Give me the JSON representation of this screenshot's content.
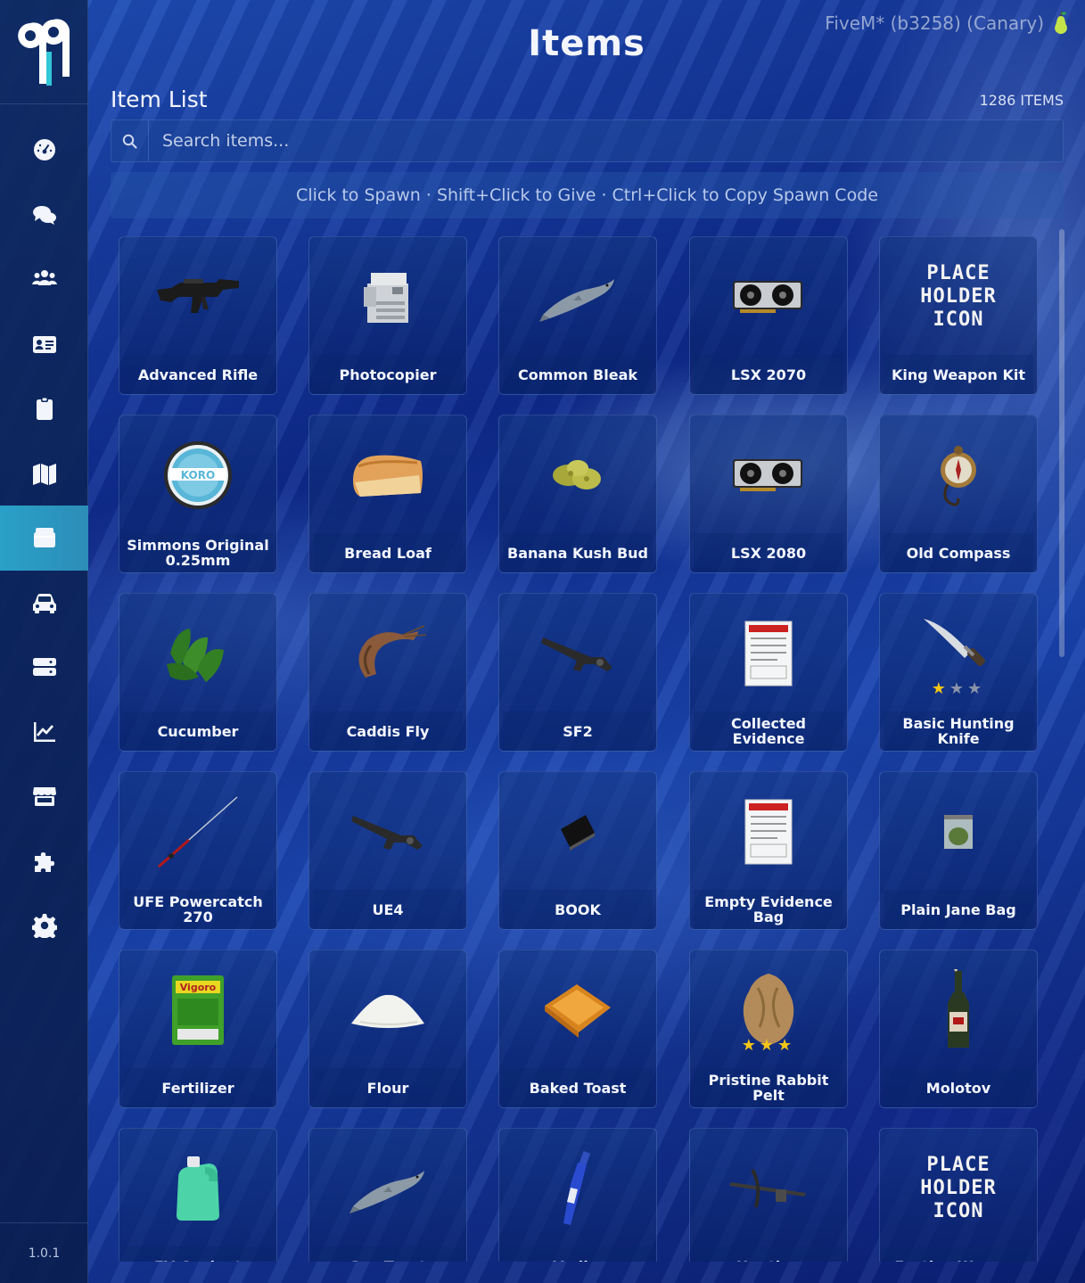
{
  "app": {
    "title": "Items",
    "build": "FiveM* (b3258) (Canary)",
    "version": "1.0.1"
  },
  "sidebar": {
    "items": [
      {
        "name": "dashboard-icon",
        "active": false
      },
      {
        "name": "chat-icon",
        "active": false
      },
      {
        "name": "players-icon",
        "active": false
      },
      {
        "name": "id-card-icon",
        "active": false
      },
      {
        "name": "clipboard-icon",
        "active": false
      },
      {
        "name": "map-icon",
        "active": false
      },
      {
        "name": "items-box-icon",
        "active": true
      },
      {
        "name": "car-icon",
        "active": false
      },
      {
        "name": "server-icon",
        "active": false
      },
      {
        "name": "chart-icon",
        "active": false
      },
      {
        "name": "store-icon",
        "active": false
      },
      {
        "name": "puzzle-icon",
        "active": false
      },
      {
        "name": "settings-gear-icon",
        "active": false
      }
    ]
  },
  "list": {
    "title": "Item List",
    "count": "1286 ITEMS",
    "search_placeholder": "Search items...",
    "hint": "Click to Spawn · Shift+Click to Give · Ctrl+Click to Copy Spawn Code"
  },
  "items": [
    {
      "label": "Advanced Rifle",
      "icon": "rifle-icon"
    },
    {
      "label": "Photocopier",
      "icon": "photocopier-icon"
    },
    {
      "label": "Common Bleak",
      "icon": "fish-icon"
    },
    {
      "label": "LSX 2070",
      "icon": "gpu-icon"
    },
    {
      "label": "King Weapon Kit",
      "icon": "placeholder-icon"
    },
    {
      "label": "Simmons Original 0.25mm",
      "icon": "tin-icon"
    },
    {
      "label": "Bread Loaf",
      "icon": "bread-icon"
    },
    {
      "label": "Banana Kush Bud",
      "icon": "bud-icon"
    },
    {
      "label": "LSX 2080",
      "icon": "gpu-icon"
    },
    {
      "label": "Old Compass",
      "icon": "compass-icon"
    },
    {
      "label": "Cucumber",
      "icon": "cucumber-icon"
    },
    {
      "label": "Caddis Fly",
      "icon": "shrimp-icon"
    },
    {
      "label": "SF2",
      "icon": "gun-icon"
    },
    {
      "label": "Collected Evidence",
      "icon": "evidence-bag-icon"
    },
    {
      "label": "Basic Hunting Knife",
      "icon": "knife-icon"
    },
    {
      "label": "UFE Powercatch 270",
      "icon": "fishing-rod-icon"
    },
    {
      "label": "UE4",
      "icon": "gun-icon"
    },
    {
      "label": "BOOK",
      "icon": "book-icon"
    },
    {
      "label": "Empty Evidence Bag",
      "icon": "evidence-bag-icon"
    },
    {
      "label": "Plain Jane Bag",
      "icon": "baggie-icon"
    },
    {
      "label": "Fertilizer",
      "icon": "fertilizer-icon"
    },
    {
      "label": "Flour",
      "icon": "flour-icon"
    },
    {
      "label": "Baked Toast",
      "icon": "toast-icon"
    },
    {
      "label": "Pristine Rabbit Pelt",
      "icon": "pelt-icon"
    },
    {
      "label": "Molotov",
      "icon": "bottle-icon"
    },
    {
      "label": "EV Coolant",
      "icon": "jug-icon"
    },
    {
      "label": "Sea Trout",
      "icon": "fish-icon"
    },
    {
      "label": "Vodka",
      "icon": "vodka-icon"
    },
    {
      "label": "Hunting",
      "icon": "crossbow-icon"
    },
    {
      "label": "Festive Weapon",
      "icon": "placeholder-icon"
    }
  ],
  "placeholder_text": [
    "PLACE",
    "HOLDER",
    "ICON"
  ],
  "colors": {
    "accent": "#2aa1c8",
    "star_gold": "#f5c518",
    "star_grey": "#8a93a8"
  }
}
